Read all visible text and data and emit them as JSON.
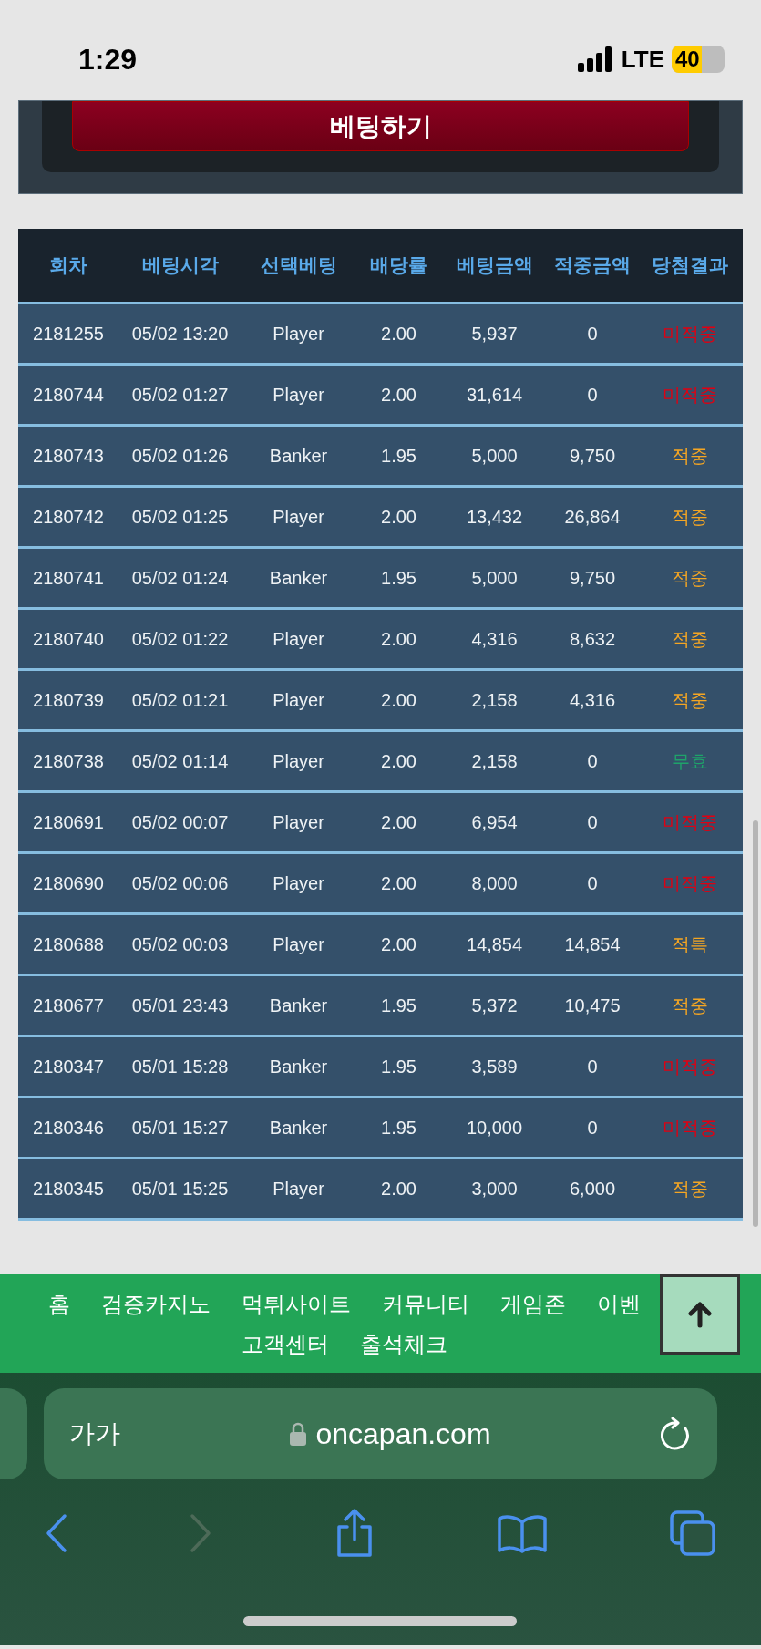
{
  "status_bar": {
    "time": "1:29",
    "network": "LTE",
    "battery": "40"
  },
  "bet_button": {
    "label": "베팅하기"
  },
  "table": {
    "columns": [
      "회차",
      "베팅시각",
      "선택베팅",
      "배당률",
      "베팅금액",
      "적중금액",
      "당첨결과"
    ],
    "rows": [
      {
        "cells": [
          "2181255",
          "05/02 13:20",
          "Player",
          "2.00",
          "5,937",
          "0"
        ],
        "result": "미적중",
        "color": "#e00012"
      },
      {
        "cells": [
          "2180744",
          "05/02 01:27",
          "Player",
          "2.00",
          "31,614",
          "0"
        ],
        "result": "미적중",
        "color": "#e00012"
      },
      {
        "cells": [
          "2180743",
          "05/02 01:26",
          "Banker",
          "1.95",
          "5,000",
          "9,750"
        ],
        "result": "적중",
        "color": "#f5a623"
      },
      {
        "cells": [
          "2180742",
          "05/02 01:25",
          "Player",
          "2.00",
          "13,432",
          "26,864"
        ],
        "result": "적중",
        "color": "#f5a623"
      },
      {
        "cells": [
          "2180741",
          "05/02 01:24",
          "Banker",
          "1.95",
          "5,000",
          "9,750"
        ],
        "result": "적중",
        "color": "#f5a623"
      },
      {
        "cells": [
          "2180740",
          "05/02 01:22",
          "Player",
          "2.00",
          "4,316",
          "8,632"
        ],
        "result": "적중",
        "color": "#f5a623"
      },
      {
        "cells": [
          "2180739",
          "05/02 01:21",
          "Player",
          "2.00",
          "2,158",
          "4,316"
        ],
        "result": "적중",
        "color": "#f5a623"
      },
      {
        "cells": [
          "2180738",
          "05/02 01:14",
          "Player",
          "2.00",
          "2,158",
          "0"
        ],
        "result": "무효",
        "color": "#1fa36a"
      },
      {
        "cells": [
          "2180691",
          "05/02 00:07",
          "Player",
          "2.00",
          "6,954",
          "0"
        ],
        "result": "미적중",
        "color": "#e00012"
      },
      {
        "cells": [
          "2180690",
          "05/02 00:06",
          "Player",
          "2.00",
          "8,000",
          "0"
        ],
        "result": "미적중",
        "color": "#e00012"
      },
      {
        "cells": [
          "2180688",
          "05/02 00:03",
          "Player",
          "2.00",
          "14,854",
          "14,854"
        ],
        "result": "적특",
        "color": "#f5a623"
      },
      {
        "cells": [
          "2180677",
          "05/01 23:43",
          "Banker",
          "1.95",
          "5,372",
          "10,475"
        ],
        "result": "적중",
        "color": "#f5a623"
      },
      {
        "cells": [
          "2180347",
          "05/01 15:28",
          "Banker",
          "1.95",
          "3,589",
          "0"
        ],
        "result": "미적중",
        "color": "#e00012"
      },
      {
        "cells": [
          "2180346",
          "05/01 15:27",
          "Banker",
          "1.95",
          "10,000",
          "0"
        ],
        "result": "미적중",
        "color": "#e00012"
      },
      {
        "cells": [
          "2180345",
          "05/01 15:25",
          "Player",
          "2.00",
          "3,000",
          "6,000"
        ],
        "result": "적중",
        "color": "#f5a623"
      }
    ]
  },
  "footer_nav": {
    "items": [
      "홈",
      "검증카지노",
      "먹튀사이트",
      "커뮤니티",
      "게임존",
      "이벤",
      "고객센터",
      "출석체크"
    ]
  },
  "browser": {
    "text_size": "가가",
    "url": "oncapan.com"
  }
}
